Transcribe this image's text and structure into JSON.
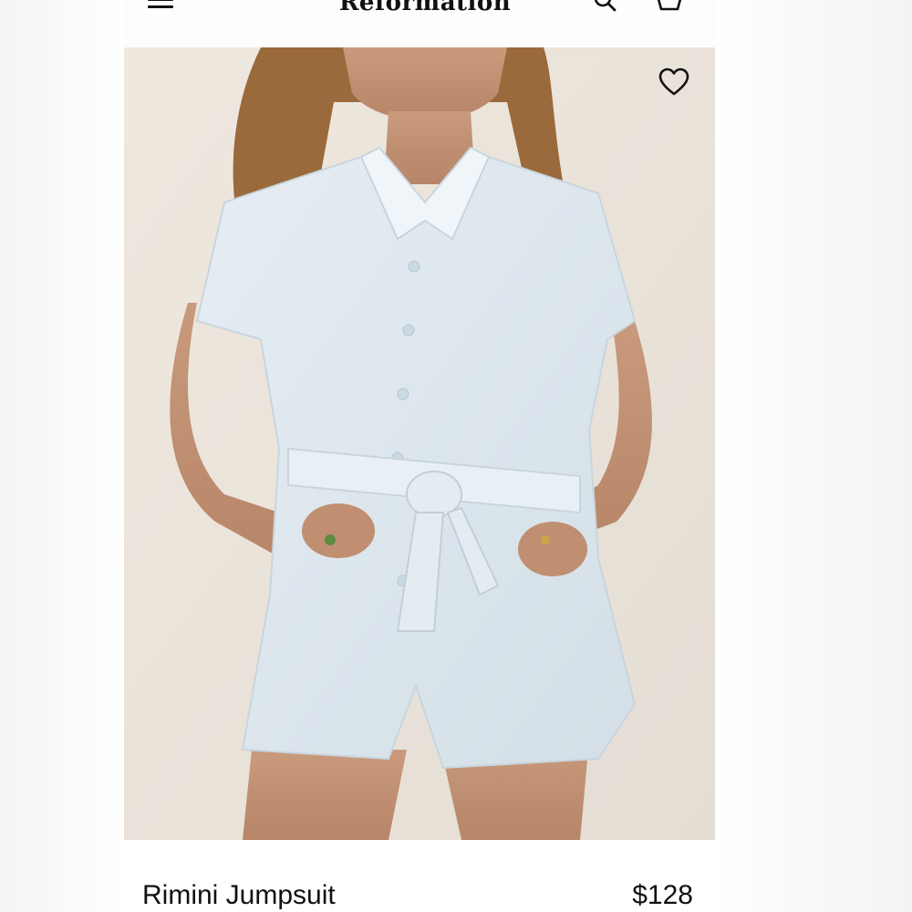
{
  "header": {
    "brand": "Reformation",
    "menu_icon": "hamburger-menu-icon",
    "search_icon": "search-icon",
    "bag_icon": "shopping-bag-icon"
  },
  "product": {
    "name": "Rimini Jumpsuit",
    "price": "$128",
    "image_alt_subject": "model wearing light blue short-sleeve terry romper with tie waist",
    "wishlist_icon": "heart-outline-icon"
  },
  "colors": {
    "background": "#ffffff",
    "text": "#111111",
    "photo_backdrop": "#ece5dd",
    "garment": "#dfe8ef"
  }
}
